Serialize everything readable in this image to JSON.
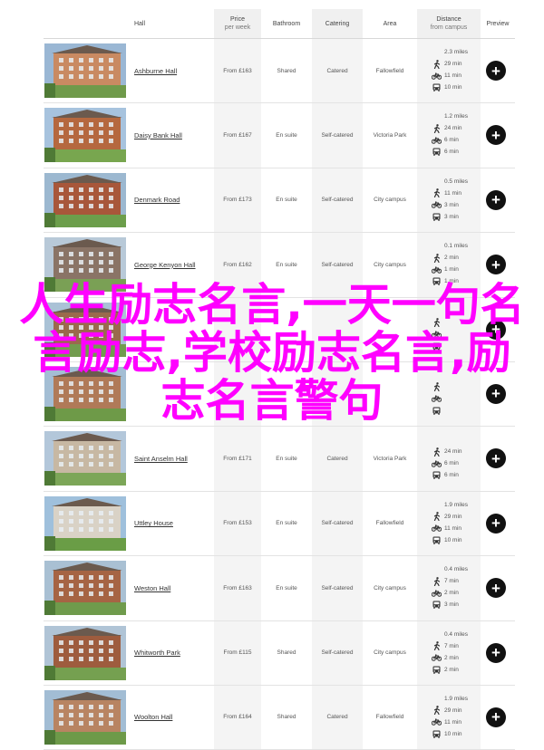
{
  "headers": {
    "hall": "Hall",
    "price_line1": "Price",
    "price_line2": "per week",
    "bathroom": "Bathroom",
    "catering": "Catering",
    "area": "Area",
    "distance_line1": "Distance",
    "distance_line2": "from campus",
    "preview": "Preview"
  },
  "rows": [
    {
      "name": "Ashburne Hall",
      "price": "From £163",
      "bathroom": "Shared",
      "catering": "Catered",
      "area": "Fallowfield",
      "walk_miles": "2.3 miles",
      "walk": "29 min",
      "bike": "11 min",
      "bus": "10 min"
    },
    {
      "name": "Daisy Bank Hall",
      "price": "From £167",
      "bathroom": "En suite",
      "catering": "Self-catered",
      "area": "Victoria Park",
      "walk_miles": "1.2 miles",
      "walk": "24 min",
      "bike": "6 min",
      "bus": "6 min"
    },
    {
      "name": "Denmark Road",
      "price": "From £173",
      "bathroom": "En suite",
      "catering": "Self-catered",
      "area": "City campus",
      "walk_miles": "0.5 miles",
      "walk": "11 min",
      "bike": "3 min",
      "bus": "3 min"
    },
    {
      "name": "George Kenyon Hall",
      "price": "From £162",
      "bathroom": "En suite",
      "catering": "Self-catered",
      "area": "City campus",
      "walk_miles": "0.1 miles",
      "walk": "2 min",
      "bike": "1 min",
      "bus": "1 min"
    },
    {
      "name": "",
      "price": "",
      "bathroom": "",
      "catering": "",
      "area": "",
      "walk_miles": "",
      "walk": "",
      "bike": "",
      "bus": ""
    },
    {
      "name": "",
      "price": "",
      "bathroom": "",
      "catering": "",
      "area": "",
      "walk_miles": "",
      "walk": "",
      "bike": "",
      "bus": ""
    },
    {
      "name": "Saint Anselm Hall",
      "price": "From £171",
      "bathroom": "En suite",
      "catering": "Catered",
      "area": "Victoria Park",
      "walk_miles": "",
      "walk": "24 min",
      "bike": "6 min",
      "bus": "6 min"
    },
    {
      "name": "Uttley House",
      "price": "From £153",
      "bathroom": "En suite",
      "catering": "Self-catered",
      "area": "Fallowfield",
      "walk_miles": "1.9 miles",
      "walk": "29 min",
      "bike": "11 min",
      "bus": "10 min"
    },
    {
      "name": "Weston Hall",
      "price": "From £163",
      "bathroom": "En suite",
      "catering": "Self-catered",
      "area": "City campus",
      "walk_miles": "0.4 miles",
      "walk": "7 min",
      "bike": "2 min",
      "bus": "3 min"
    },
    {
      "name": "Whitworth Park",
      "price": "From £115",
      "bathroom": "Shared",
      "catering": "Self-catered",
      "area": "City campus",
      "walk_miles": "0.4 miles",
      "walk": "7 min",
      "bike": "2 min",
      "bus": "2 min"
    },
    {
      "name": "Woolton Hall",
      "price": "From £164",
      "bathroom": "Shared",
      "catering": "Catered",
      "area": "Fallowfield",
      "walk_miles": "1.9 miles",
      "walk": "29 min",
      "bike": "11 min",
      "bus": "10 min"
    }
  ],
  "preview_icon": "plus-circle-icon",
  "overlay_text": "人生励志名言,一天一句名言励志,学校励志名言,励志名言警句",
  "colors": {
    "overlay": "#ff00ff",
    "preview_button": "#111111",
    "column_shade": "#f4f4f4"
  }
}
